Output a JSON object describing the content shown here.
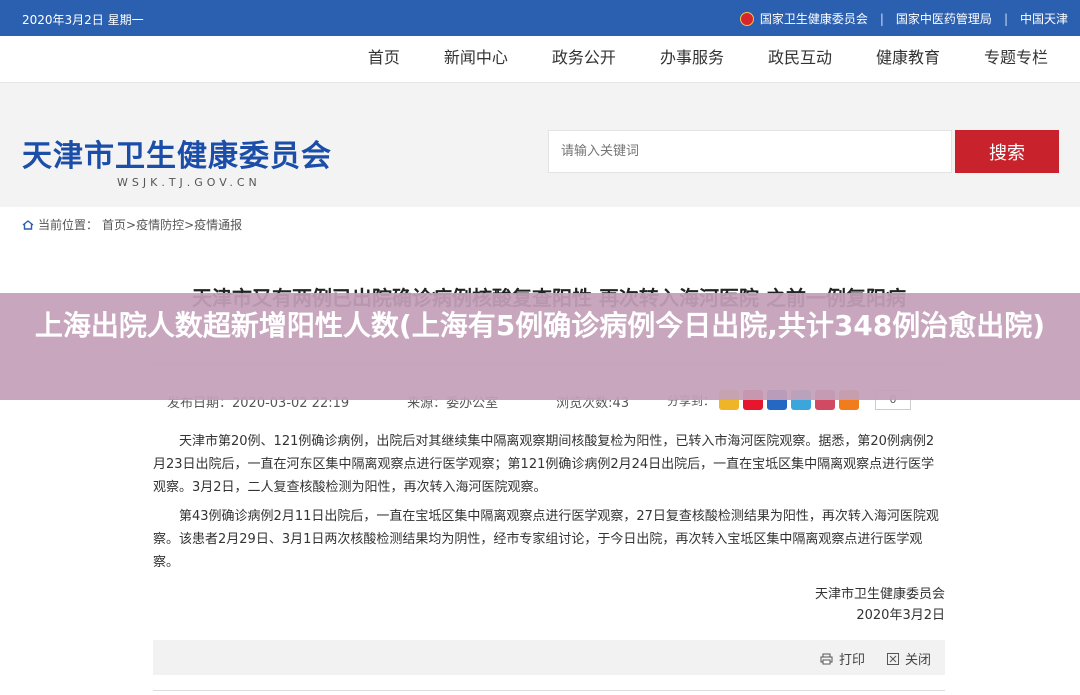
{
  "topbar": {
    "date": "2020年3月2日 星期一",
    "links": [
      "国家卫生健康委员会",
      "国家中医药管理局",
      "中国天津"
    ],
    "separator": "|"
  },
  "nav": {
    "items": [
      "首页",
      "新闻中心",
      "政务公开",
      "办事服务",
      "政民互动",
      "健康教育",
      "专题专栏"
    ]
  },
  "header": {
    "logo_title": "天津市卫生健康委员会",
    "logo_subtitle": "WSJK.TJ.GOV.CN",
    "search_placeholder": "请输入关键词",
    "search_button": "搜索"
  },
  "breadcrumb": {
    "label": "当前位置：",
    "path": "首页>疫情防控>疫情通报"
  },
  "article": {
    "title": "天津市又有两例已出院确诊病例核酸复查阳性 再次转入海河医院 之前一例复阳病",
    "publish_date": "发布日期：2020-03-02 22:19",
    "source": "来源：委办公室",
    "views": "浏览次数:43",
    "share_label": "分享到：",
    "share_count": "0",
    "paragraphs": [
      "天津市第20例、121例确诊病例，出院后对其继续集中隔离观察期间核酸复检为阳性，已转入市海河医院观察。据悉，第20例病例2月23日出院后，一直在河东区集中隔离观察点进行医学观察；第121例确诊病例2月24日出院后，一直在宝坻区集中隔离观察点进行医学观察。3月2日，二人复查核酸检测为阳性，再次转入海河医院观察。",
      "第43例确诊病例2月11日出院后，一直在宝坻区集中隔离观察点进行医学观察，27日复查核酸检测结果为阳性，再次转入海河医院观察。该患者2月29日、3月1日两次核酸检测结果均为阴性，经市专家组讨论，于今日出院，再次转入宝坻区集中隔离观察点进行医学观察。"
    ],
    "signature_org": "天津市卫生健康委员会",
    "signature_date": "2020年3月2日",
    "print_label": "打印",
    "close_label": "关闭"
  },
  "overlay": {
    "headline": "上海出院人数超新增阳性人数(上海有5例确诊病例今日出院,共计348例治愈出院)"
  },
  "colors": {
    "topbar": "#2b5fb0",
    "brand_blue": "#1b4ea8",
    "search_red": "#c8222c",
    "overlay": "#c4a0b9"
  },
  "share_icons": [
    "qzone-icon",
    "weibo-icon",
    "renren-icon",
    "tencent-weibo-icon",
    "wechat-icon",
    "more-share-icon"
  ]
}
